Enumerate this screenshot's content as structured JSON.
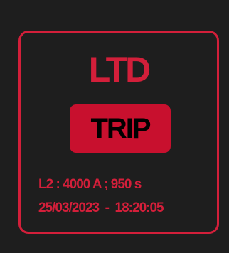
{
  "colors": {
    "background": "#1e1e1e",
    "accent": "#d31f3a",
    "badge_fill": "#c8102e",
    "badge_text": "#000000"
  },
  "panel": {
    "title": "LTD",
    "status_badge": "TRIP",
    "detail_line": "L2 : 4000 A ; 950 s",
    "timestamp": "25/03/2023  -  18:20:05"
  }
}
